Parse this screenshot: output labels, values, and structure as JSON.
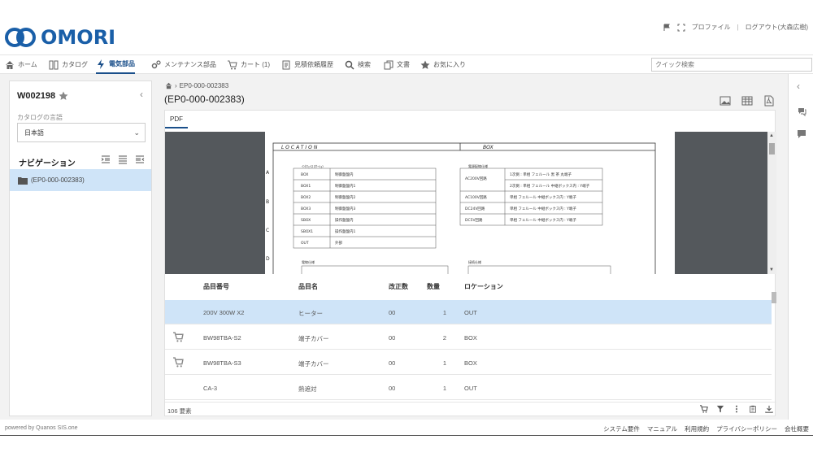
{
  "header": {
    "logo_text": "OMORI",
    "top_links": [
      "プロファイル",
      "ログアウト(大森広樹)"
    ],
    "top_sep": "|"
  },
  "nav": {
    "items": [
      {
        "label": "ホーム",
        "icon": "home-icon"
      },
      {
        "label": "カタログ",
        "icon": "catalog-icon"
      },
      {
        "label": "電気部品",
        "icon": "bolt-icon",
        "active": true
      },
      {
        "label": "メンテナンス部品",
        "icon": "gears-icon"
      },
      {
        "label": "カート (1)",
        "icon": "cart-icon"
      },
      {
        "label": "見積依頼履歴",
        "icon": "document-icon"
      },
      {
        "label": "検索",
        "icon": "search-icon"
      },
      {
        "label": "文書",
        "icon": "copy-icon"
      },
      {
        "label": "お気に入り",
        "icon": "star-icon"
      }
    ],
    "quick_search_placeholder": "クイック検索"
  },
  "left": {
    "title": "W002198",
    "lang_label": "カタログの言語",
    "lang_value": "日本語",
    "nav_label": "ナビゲーション",
    "tree_item": "(EP0-000-002383)"
  },
  "main": {
    "breadcrumb": "EP0-000-002383",
    "title": "(EP0-000-002383)",
    "tab": "PDF"
  },
  "drawing": {
    "hdr_location": "LOCATION",
    "hdr_box": "BOX",
    "row_labels": [
      "A",
      "B",
      "C",
      "D"
    ],
    "left_table_title": "ｲﾝﾀﾌｪｲｽ ﾛｹｰｼｮﾝ",
    "left_codes": [
      "BOX",
      "BOX1",
      "BOX2",
      "BOX3",
      "SBOX",
      "SBOX1",
      "OUT"
    ],
    "left_desc": [
      "制御盤盤内",
      "制御盤盤内1",
      "制御盤盤内2",
      "制御盤盤内3",
      "操作盤盤内",
      "操作盤盤内1",
      "外部"
    ],
    "right_table_title": "電源配線仕様",
    "right_codes": [
      "AC200V回路",
      "",
      "AC100V回路",
      "DC24V回路",
      "DC5V回路"
    ],
    "right_desc": [
      "1次側 : 単相 フェルール  黒 茶  丸端子",
      "2次側 : 単相 フェルール  中継ボックス内 : Y端子",
      "単相 フェルール  中継ボックス内 : Y端子",
      "単相 フェルール  中継ボックス内 : Y端子",
      "単相 フェルール  中継ボックス内 : Y端子"
    ],
    "bottom_left_title": "電線仕様",
    "bottom_right_title": "接続仕様"
  },
  "table": {
    "headers": [
      "品目番号",
      "品目名",
      "改正数",
      "数量",
      "ロケーション"
    ],
    "rows": [
      {
        "part": "200V 300W X2",
        "name": "ヒーター",
        "rev": "00",
        "qty": "1",
        "loc": "OUT",
        "cart": false,
        "selected": true
      },
      {
        "part": "BW98TBA-S2",
        "name": "端子カバー",
        "rev": "00",
        "qty": "2",
        "loc": "BOX",
        "cart": true,
        "selected": false
      },
      {
        "part": "BW98TBA-S3",
        "name": "端子カバー",
        "rev": "00",
        "qty": "1",
        "loc": "BOX",
        "cart": true,
        "selected": false
      },
      {
        "part": "CA-3",
        "name": "熱遮対",
        "rev": "00",
        "qty": "1",
        "loc": "OUT",
        "cart": false,
        "selected": false
      }
    ],
    "record_count": "106 要素"
  },
  "footer": {
    "powered": "powered by Quanos SIS.one",
    "links": [
      "システム要件",
      "マニュアル",
      "利用規約",
      "プライバシーポリシー",
      "会社概要"
    ]
  },
  "colors": {
    "brand": "#1a5fa8",
    "active_nav": "#1a4f8a",
    "selection": "#cfe4f8"
  }
}
